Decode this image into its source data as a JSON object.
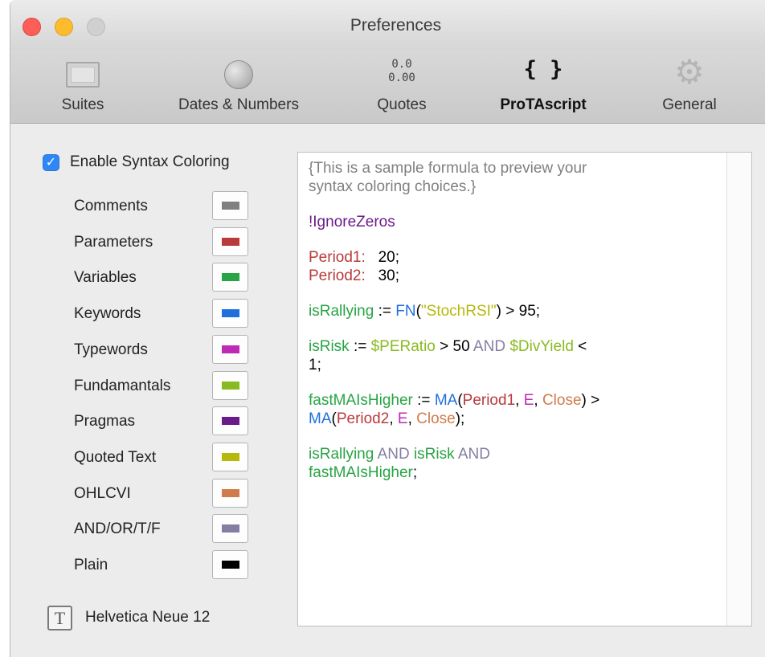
{
  "window": {
    "title": "Preferences"
  },
  "toolbar": {
    "items": [
      {
        "label": "Suites",
        "icon": "suites-icon"
      },
      {
        "label": "Dates & Numbers",
        "icon": "globe-icon"
      },
      {
        "label": "Quotes",
        "icon": "quotes-icon",
        "icon_text": [
          "0.0",
          "0.00"
        ]
      },
      {
        "label": "ProTAscript",
        "icon": "braces-icon",
        "icon_text": "{ }",
        "selected": true
      },
      {
        "label": "General",
        "icon": "gear-icon"
      }
    ]
  },
  "syntax": {
    "enable_label": "Enable Syntax Coloring",
    "enabled": true,
    "colors": [
      {
        "label": "Comments",
        "color": "#808080"
      },
      {
        "label": "Parameters",
        "color": "#b83a3a"
      },
      {
        "label": "Variables",
        "color": "#27a444"
      },
      {
        "label": "Keywords",
        "color": "#1f6fdc"
      },
      {
        "label": "Typewords",
        "color": "#be2ab4"
      },
      {
        "label": "Fundamantals",
        "color": "#8aba21"
      },
      {
        "label": "Pragmas",
        "color": "#6a1b8a"
      },
      {
        "label": "Quoted Text",
        "color": "#b6b80d"
      },
      {
        "label": "OHLCVI",
        "color": "#d07b4d"
      },
      {
        "label": "AND/OR/T/F",
        "color": "#847ea3"
      },
      {
        "label": "Plain",
        "color": "#000000"
      }
    ]
  },
  "font": {
    "label": "Helvetica Neue 12",
    "icon": "font-icon"
  },
  "preview": {
    "colors": {
      "comment": "#808080",
      "parameter": "#b83a3a",
      "variable": "#27a444",
      "keyword": "#1f6fdc",
      "typeword": "#be2ab4",
      "fundamental": "#8aba21",
      "pragma": "#6a1b8a",
      "quoted": "#b6b80d",
      "ohlcvi": "#d07b4d",
      "logical": "#847ea3",
      "plain": "#000000"
    },
    "paragraphs": [
      [
        [
          {
            "t": "{This is a sample formula to preview your",
            "c": "comment"
          }
        ],
        [
          {
            "t": "syntax coloring choices.}",
            "c": "comment"
          }
        ]
      ],
      [
        [
          {
            "t": "!IgnoreZeros",
            "c": "pragma"
          }
        ]
      ],
      [
        [
          {
            "t": "Period1:",
            "c": "parameter"
          },
          {
            "t": "   20;",
            "c": "plain"
          }
        ],
        [
          {
            "t": "Period2:",
            "c": "parameter"
          },
          {
            "t": "   30;",
            "c": "plain"
          }
        ]
      ],
      [
        [
          {
            "t": "isRallying",
            "c": "variable"
          },
          {
            "t": " := ",
            "c": "plain"
          },
          {
            "t": "FN",
            "c": "keyword"
          },
          {
            "t": "(",
            "c": "plain"
          },
          {
            "t": "\"StochRSI\"",
            "c": "quoted"
          },
          {
            "t": ") > 95;",
            "c": "plain"
          }
        ]
      ],
      [
        [
          {
            "t": "isRisk",
            "c": "variable"
          },
          {
            "t": " := ",
            "c": "plain"
          },
          {
            "t": "$PERatio",
            "c": "fundamental"
          },
          {
            "t": " > 50 ",
            "c": "plain"
          },
          {
            "t": "AND",
            "c": "logical"
          },
          {
            "t": " ",
            "c": "plain"
          },
          {
            "t": "$DivYield",
            "c": "fundamental"
          },
          {
            "t": " <",
            "c": "plain"
          }
        ],
        [
          {
            "t": "1;",
            "c": "plain"
          }
        ]
      ],
      [
        [
          {
            "t": "fastMAIsHigher",
            "c": "variable"
          },
          {
            "t": " := ",
            "c": "plain"
          },
          {
            "t": "MA",
            "c": "keyword"
          },
          {
            "t": "(",
            "c": "plain"
          },
          {
            "t": "Period1",
            "c": "parameter"
          },
          {
            "t": ", ",
            "c": "plain"
          },
          {
            "t": "E",
            "c": "typeword"
          },
          {
            "t": ", ",
            "c": "plain"
          },
          {
            "t": "Close",
            "c": "ohlcvi"
          },
          {
            "t": ") >",
            "c": "plain"
          }
        ],
        [
          {
            "t": "MA",
            "c": "keyword"
          },
          {
            "t": "(",
            "c": "plain"
          },
          {
            "t": "Period2",
            "c": "parameter"
          },
          {
            "t": ", ",
            "c": "plain"
          },
          {
            "t": "E",
            "c": "typeword"
          },
          {
            "t": ", ",
            "c": "plain"
          },
          {
            "t": "Close",
            "c": "ohlcvi"
          },
          {
            "t": ");",
            "c": "plain"
          }
        ]
      ],
      [
        [
          {
            "t": "isRallying",
            "c": "variable"
          },
          {
            "t": " ",
            "c": "plain"
          },
          {
            "t": "AND",
            "c": "logical"
          },
          {
            "t": " ",
            "c": "plain"
          },
          {
            "t": "isRisk",
            "c": "variable"
          },
          {
            "t": " ",
            "c": "plain"
          },
          {
            "t": "AND",
            "c": "logical"
          }
        ],
        [
          {
            "t": "fastMAIsHigher",
            "c": "variable"
          },
          {
            "t": ";",
            "c": "plain"
          }
        ]
      ]
    ]
  }
}
